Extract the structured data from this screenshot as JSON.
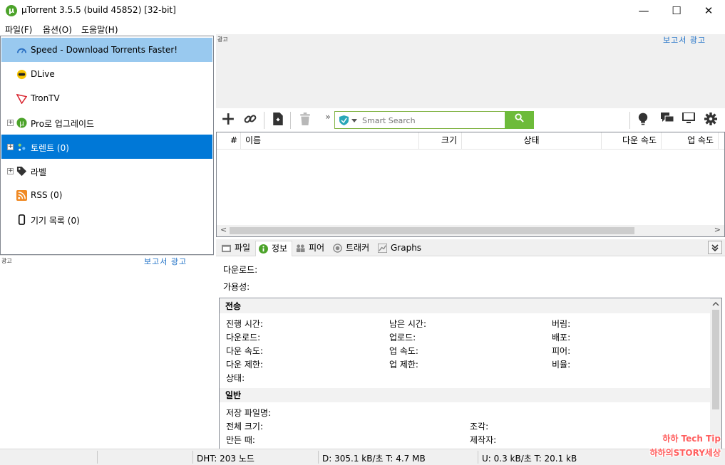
{
  "window": {
    "title": "µTorrent 3.5.5  (build 45852) [32-bit]",
    "minimize": "—",
    "maximize": "☐",
    "close": "✕"
  },
  "menu": [
    "파일(F)",
    "옵션(O)",
    "도움말(H)"
  ],
  "sidebar": {
    "items": [
      {
        "label": "Speed - Download Torrents Faster!",
        "icon": "speedometer-icon"
      },
      {
        "label": "DLive",
        "icon": "dlive-icon"
      },
      {
        "label": "TronTV",
        "icon": "tron-icon"
      },
      {
        "label": "Pro로 업그레이드",
        "icon": "utorrent-logo-icon"
      },
      {
        "label": "토렌트 (0)",
        "icon": "torrents-icon"
      },
      {
        "label": "라벨",
        "icon": "tag-icon"
      },
      {
        "label": "RSS (0)",
        "icon": "rss-icon"
      },
      {
        "label": "기기 목록 (0)",
        "icon": "device-icon"
      }
    ],
    "expanders": [
      "+",
      "+",
      "+"
    ]
  },
  "ads": {
    "tag": "광고",
    "report": "보고서 광고"
  },
  "toolbar": {
    "search_placeholder": "Smart Search",
    "more": "»",
    "colors": {
      "search_green": "#6dbb3a"
    }
  },
  "list": {
    "columns": [
      "#",
      "이름",
      "크기",
      "상태",
      "다운 속도",
      "업 속도"
    ],
    "scroll_left": "<",
    "scroll_right": ">"
  },
  "tabs": [
    {
      "label": "파일",
      "icon": "folder-icon"
    },
    {
      "label": "정보",
      "icon": "info-icon"
    },
    {
      "label": "피어",
      "icon": "peers-icon"
    },
    {
      "label": "트래커",
      "icon": "tracker-icon"
    },
    {
      "label": "Graphs",
      "icon": "graph-icon"
    }
  ],
  "detail": {
    "download_label": "다운로드:",
    "availability_label": "가용성:",
    "transfer": {
      "heading": "전송",
      "col1": [
        "진행 시간:",
        "다운로드:",
        "다운 속도:",
        "다운 제한:",
        "상태:"
      ],
      "col2": [
        "남은 시간:",
        "업로드:",
        "업 속도:",
        "업 제한:"
      ],
      "col3": [
        "버림:",
        "배포:",
        "피어:",
        "비율:"
      ]
    },
    "general": {
      "heading": "일반",
      "col1": [
        "저장 파일명:",
        "전체 크기:",
        "만든 때:"
      ],
      "col2": [
        "조각:",
        "제작자:"
      ]
    }
  },
  "status": {
    "dht": "DHT: 203 노드",
    "download": "D: 305.1 kB/초 T: 4.7 MB",
    "upload": "U: 0.3 kB/초 T: 20.1 kB"
  },
  "watermark": {
    "line1": "하하 Tech Tip",
    "line2": "하하의STORY세상"
  }
}
